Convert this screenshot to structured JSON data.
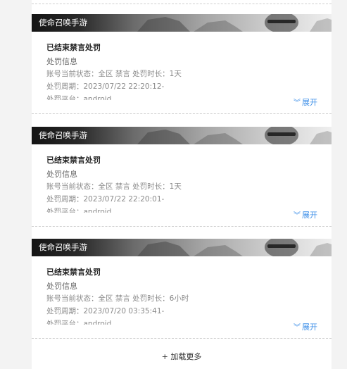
{
  "records": [
    {
      "game": "使命召唤手游",
      "title": "已结束禁言处罚",
      "section": "处罚信息",
      "details": [
        "账号当前状态：全区 禁言   处罚时长：1天",
        "处罚周期：2023/07/22 22:20:12-",
        "处罚平台：android"
      ],
      "expand_label": "展开"
    },
    {
      "game": "使命召唤手游",
      "title": "已结束禁言处罚",
      "section": "处罚信息",
      "details": [
        "账号当前状态：全区 禁言   处罚时长：1天",
        "处罚周期：2023/07/22 22:20:01-",
        "处罚平台：android"
      ],
      "expand_label": "展开"
    },
    {
      "game": "使命召唤手游",
      "title": "已结束禁言处罚",
      "section": "处罚信息",
      "details": [
        "账号当前状态：全区 禁言   处罚时长：6小时",
        "处罚周期：2023/07/20 03:35:41-",
        "处罚平台：android"
      ],
      "expand_label": "展开"
    }
  ],
  "load_more_label": "+ 加载更多",
  "colors": {
    "accent": "#3d8fe8",
    "banner_dark": "#141414",
    "banner_light": "#efefef"
  }
}
